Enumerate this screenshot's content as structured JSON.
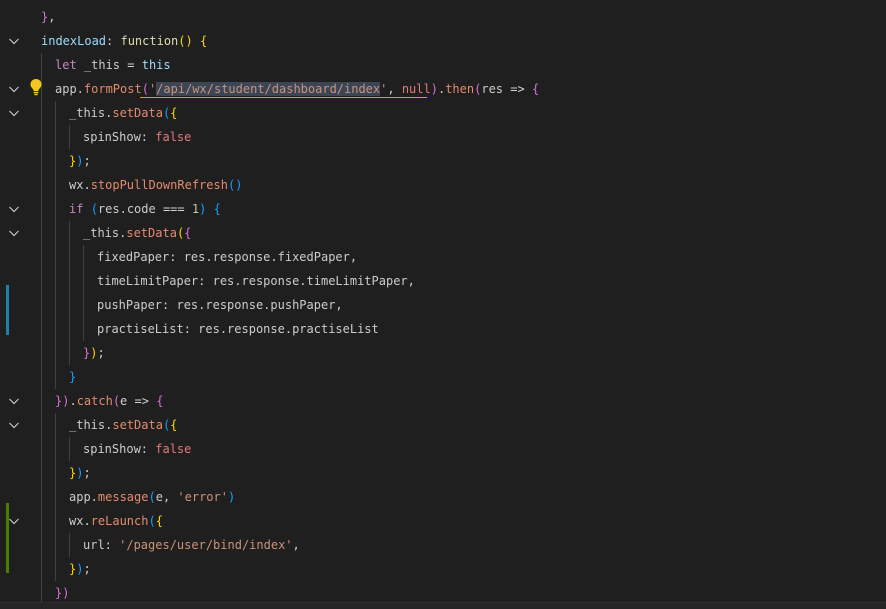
{
  "editor": {
    "language": "javascript",
    "lines": [
      {
        "indent": 1,
        "tokens": [
          [
            "br2",
            "}"
          ],
          [
            "plain",
            ","
          ]
        ]
      },
      {
        "indent": 1,
        "fold": true,
        "tokens": [
          [
            "prop",
            "indexLoad"
          ],
          [
            "plain",
            ": "
          ],
          [
            "fn",
            "function"
          ],
          [
            "br1",
            "()"
          ],
          [
            "plain",
            " "
          ],
          [
            "br1",
            "{"
          ]
        ]
      },
      {
        "indent": 2,
        "tokens": [
          [
            "kw",
            "let"
          ],
          [
            "plain",
            " _this "
          ],
          [
            "op",
            "="
          ],
          [
            "plain",
            " "
          ],
          [
            "this",
            "this"
          ]
        ]
      },
      {
        "indent": 2,
        "fold": true,
        "bulb": true,
        "tokens": [
          [
            "plain",
            "app."
          ],
          [
            "method",
            "formPost"
          ],
          [
            "br2",
            "("
          ],
          [
            "str",
            "'"
          ],
          [
            "strsel",
            "/api/wx/student/dashboard/index"
          ],
          [
            "str",
            "'"
          ],
          [
            "plain",
            ", "
          ],
          [
            "bool",
            "null"
          ],
          [
            "br2",
            ")"
          ],
          [
            "plain",
            "."
          ],
          [
            "method",
            "then"
          ],
          [
            "br2",
            "("
          ],
          [
            "plain",
            "res "
          ],
          [
            "op",
            "=>"
          ],
          [
            "plain",
            " "
          ],
          [
            "br2",
            "{"
          ]
        ]
      },
      {
        "indent": 3,
        "fold": true,
        "tokens": [
          [
            "plain",
            "_this."
          ],
          [
            "method",
            "setData"
          ],
          [
            "br3",
            "("
          ],
          [
            "br1",
            "{"
          ]
        ]
      },
      {
        "indent": 4,
        "tokens": [
          [
            "plain",
            "spinShow"
          ],
          [
            "plain",
            ": "
          ],
          [
            "bool",
            "false"
          ]
        ]
      },
      {
        "indent": 3,
        "tokens": [
          [
            "br1",
            "}"
          ],
          [
            "br3",
            ")"
          ],
          [
            "plain",
            ";"
          ]
        ]
      },
      {
        "indent": 3,
        "tokens": [
          [
            "plain",
            "wx."
          ],
          [
            "method",
            "stopPullDownRefresh"
          ],
          [
            "br3",
            "()"
          ]
        ]
      },
      {
        "indent": 3,
        "fold": true,
        "tokens": [
          [
            "ctl",
            "if"
          ],
          [
            "plain",
            " "
          ],
          [
            "br3",
            "("
          ],
          [
            "plain",
            "res.code "
          ],
          [
            "op",
            "==="
          ],
          [
            "plain",
            " "
          ],
          [
            "num",
            "1"
          ],
          [
            "br3",
            ")"
          ],
          [
            "plain",
            " "
          ],
          [
            "br3",
            "{"
          ]
        ]
      },
      {
        "indent": 4,
        "fold": true,
        "tokens": [
          [
            "plain",
            "_this."
          ],
          [
            "method",
            "setData"
          ],
          [
            "br1",
            "("
          ],
          [
            "br2",
            "{"
          ]
        ]
      },
      {
        "indent": 5,
        "tokens": [
          [
            "plain",
            "fixedPaper: res.response.fixedPaper,"
          ]
        ]
      },
      {
        "indent": 5,
        "tokens": [
          [
            "plain",
            "timeLimitPaper: res.response.timeLimitPaper,"
          ]
        ]
      },
      {
        "indent": 5,
        "tokens": [
          [
            "plain",
            "pushPaper: res.response.pushPaper,"
          ]
        ]
      },
      {
        "indent": 5,
        "tokens": [
          [
            "plain",
            "practiseList: res.response.practiseList"
          ]
        ]
      },
      {
        "indent": 4,
        "tokens": [
          [
            "br2",
            "}"
          ],
          [
            "br1",
            ")"
          ],
          [
            "plain",
            ";"
          ]
        ]
      },
      {
        "indent": 3,
        "tokens": [
          [
            "br3",
            "}"
          ]
        ]
      },
      {
        "indent": 2,
        "fold": true,
        "tokens": [
          [
            "br2",
            "})"
          ],
          [
            "plain",
            "."
          ],
          [
            "method",
            "catch"
          ],
          [
            "br2",
            "("
          ],
          [
            "plain",
            "e "
          ],
          [
            "op",
            "=>"
          ],
          [
            "plain",
            " "
          ],
          [
            "br2",
            "{"
          ]
        ]
      },
      {
        "indent": 3,
        "fold": true,
        "tokens": [
          [
            "plain",
            "_this."
          ],
          [
            "method",
            "setData"
          ],
          [
            "br3",
            "("
          ],
          [
            "br1",
            "{"
          ]
        ]
      },
      {
        "indent": 4,
        "tokens": [
          [
            "plain",
            "spinShow"
          ],
          [
            "plain",
            ": "
          ],
          [
            "bool",
            "false"
          ]
        ]
      },
      {
        "indent": 3,
        "tokens": [
          [
            "br1",
            "}"
          ],
          [
            "br3",
            ")"
          ],
          [
            "plain",
            ";"
          ]
        ]
      },
      {
        "indent": 3,
        "tokens": [
          [
            "plain",
            "app."
          ],
          [
            "method",
            "message"
          ],
          [
            "br3",
            "("
          ],
          [
            "plain",
            "e, "
          ],
          [
            "str",
            "'error'"
          ],
          [
            "br3",
            ")"
          ]
        ]
      },
      {
        "indent": 3,
        "fold": true,
        "tokens": [
          [
            "plain",
            "wx."
          ],
          [
            "method",
            "reLaunch"
          ],
          [
            "br3",
            "("
          ],
          [
            "br1",
            "{"
          ]
        ]
      },
      {
        "indent": 4,
        "tokens": [
          [
            "plain",
            "url: "
          ],
          [
            "str",
            "'/pages/user/bind/index'"
          ],
          [
            "plain",
            ","
          ]
        ]
      },
      {
        "indent": 3,
        "tokens": [
          [
            "br1",
            "}"
          ],
          [
            "br3",
            ")"
          ],
          [
            "plain",
            ";"
          ]
        ]
      },
      {
        "indent": 2,
        "tokens": [
          [
            "br2",
            "})"
          ]
        ]
      }
    ]
  },
  "colors": {
    "background": "#1f1f1f",
    "indent_guide": "#404040",
    "selection": "#3a4656",
    "warning_underline": "#c9a227",
    "diff_modified": "#1b81a8",
    "diff_added": "#487e02",
    "lightbulb": "#f3c623"
  },
  "icons": {
    "fold": "chevron-down-icon",
    "hint": "lightbulb-icon"
  }
}
